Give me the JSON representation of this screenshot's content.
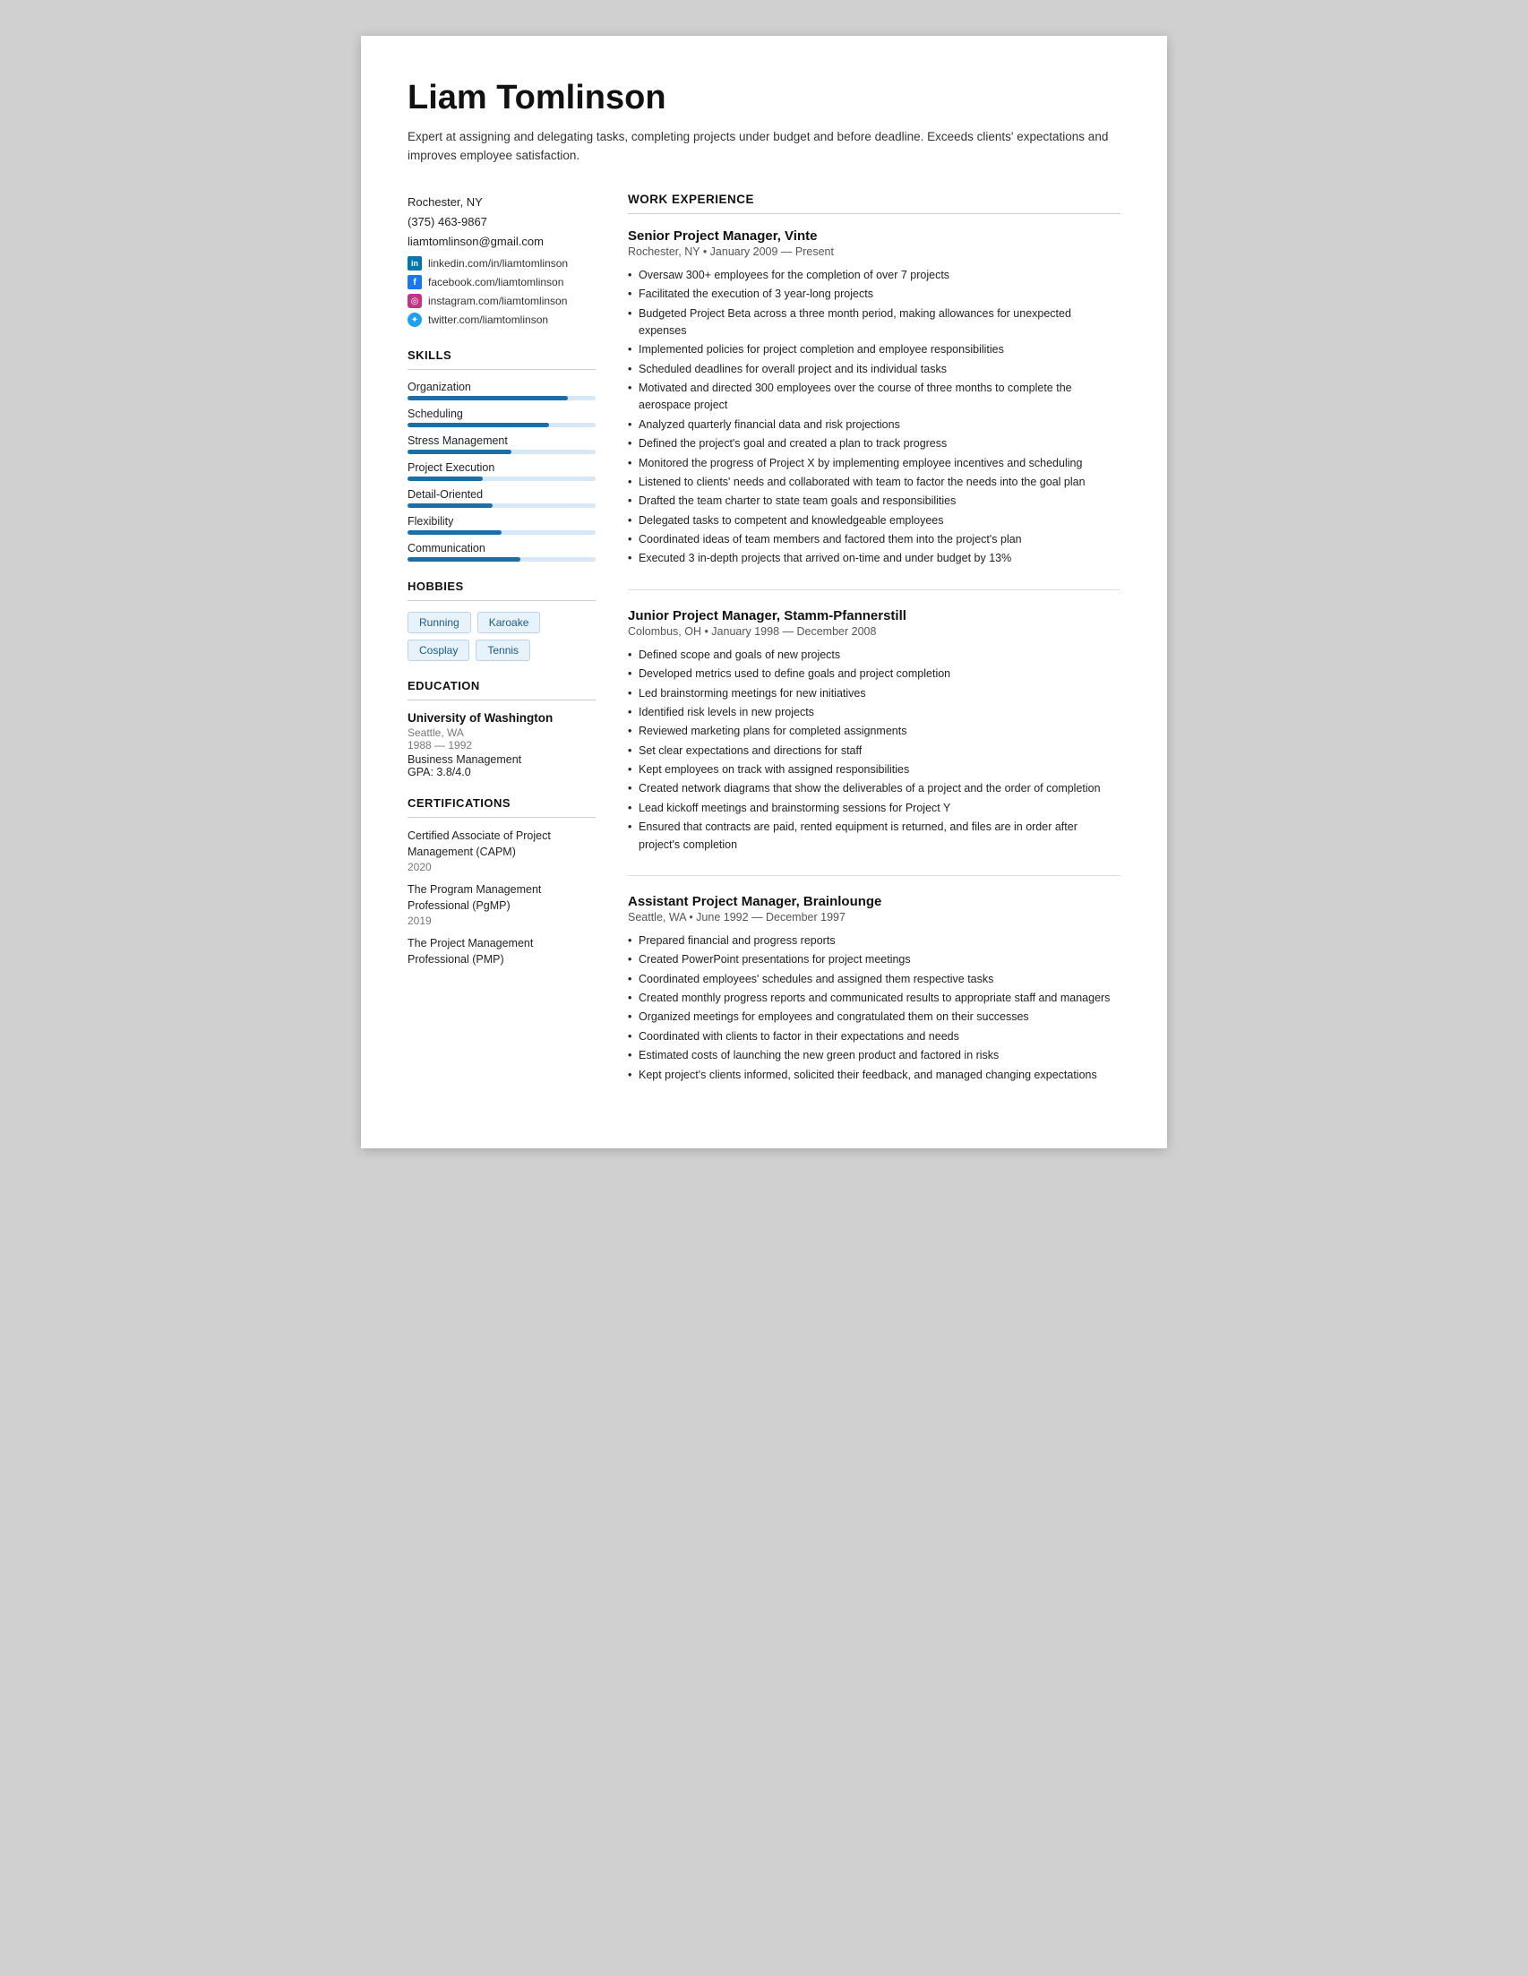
{
  "header": {
    "name": "Liam Tomlinson",
    "summary": "Expert at assigning and delegating tasks, completing projects under budget and before deadline. Exceeds clients' expectations and improves employee satisfaction."
  },
  "contact": {
    "location": "Rochester, NY",
    "phone": "(375) 463-9867",
    "email": "liamtomlinson@gmail.com",
    "socials": [
      {
        "id": "linkedin",
        "icon": "in",
        "label": "linkedin.com/in/liamtomlinson"
      },
      {
        "id": "facebook",
        "icon": "f",
        "label": "facebook.com/liamtomlinson"
      },
      {
        "id": "instagram",
        "icon": "◎",
        "label": "instagram.com/liamtomlinson"
      },
      {
        "id": "twitter",
        "icon": "✦",
        "label": "twitter.com/liamtomlinson"
      }
    ]
  },
  "skills": {
    "section_title": "SKILLS",
    "items": [
      {
        "label": "Organization",
        "pct": 85
      },
      {
        "label": "Scheduling",
        "pct": 75
      },
      {
        "label": "Stress Management",
        "pct": 55
      },
      {
        "label": "Project Execution",
        "pct": 40
      },
      {
        "label": "Detail-Oriented",
        "pct": 45
      },
      {
        "label": "Flexibility",
        "pct": 50
      },
      {
        "label": "Communication",
        "pct": 60
      }
    ]
  },
  "hobbies": {
    "section_title": "HOBBIES",
    "items": [
      "Running",
      "Karoake",
      "Cosplay",
      "Tennis"
    ]
  },
  "education": {
    "section_title": "EDUCATION",
    "entries": [
      {
        "school": "University of Washington",
        "location": "Seattle, WA",
        "years": "1988 — 1992",
        "field": "Business Management",
        "gpa": "GPA: 3.8/4.0"
      }
    ]
  },
  "certifications": {
    "section_title": "CERTIFICATIONS",
    "entries": [
      {
        "name": "Certified Associate of Project Management (CAPM)",
        "year": "2020"
      },
      {
        "name": "The Program Management Professional (PgMP)",
        "year": "2019"
      },
      {
        "name": "The Project Management Professional (PMP)",
        "year": ""
      }
    ]
  },
  "work_experience": {
    "section_title": "WORK EXPERIENCE",
    "jobs": [
      {
        "title": "Senior Project Manager, Vinte",
        "meta": "Rochester, NY • January 2009 — Present",
        "bullets": [
          "Oversaw 300+ employees for the completion of over 7 projects",
          "Facilitated the execution of 3 year-long projects",
          "Budgeted Project Beta across a three month period, making allowances for unexpected expenses",
          "Implemented policies for project completion and employee responsibilities",
          "Scheduled deadlines for overall project and its individual tasks",
          "Motivated and directed 300 employees over the course of three months to complete the aerospace project",
          "Analyzed quarterly financial data and risk projections",
          "Defined the project's goal and created a plan to track progress",
          "Monitored the progress of Project X by implementing employee incentives and scheduling",
          "Listened to clients' needs and collaborated with team to factor the needs into the goal plan",
          "Drafted the team charter to state team goals and responsibilities",
          "Delegated tasks to competent and knowledgeable employees",
          "Coordinated ideas of team members and factored them into the project's plan",
          "Executed 3 in-depth projects that arrived on-time and under budget by 13%"
        ]
      },
      {
        "title": "Junior Project Manager, Stamm-Pfannerstill",
        "meta": "Colombus, OH • January 1998 — December 2008",
        "bullets": [
          "Defined scope and goals of new projects",
          "Developed metrics used to define goals and project completion",
          "Led brainstorming meetings for new initiatives",
          "Identified risk levels in new projects",
          "Reviewed marketing plans for completed assignments",
          "Set clear expectations and directions for staff",
          "Kept employees on track with assigned responsibilities",
          "Created network diagrams that show the deliverables of a project and the order of completion",
          "Lead kickoff meetings and brainstorming sessions for Project Y",
          "Ensured that contracts are paid, rented equipment is returned, and files are in order after project's completion"
        ]
      },
      {
        "title": "Assistant Project Manager, Brainlounge",
        "meta": "Seattle, WA • June 1992 — December 1997",
        "bullets": [
          "Prepared financial and progress reports",
          "Created PowerPoint presentations for project meetings",
          "Coordinated employees' schedules and assigned them respective tasks",
          "Created monthly progress reports and communicated results to appropriate staff and managers",
          "Organized meetings for employees and congratulated them on their successes",
          "Coordinated with clients to factor in their expectations and needs",
          "Estimated costs of launching the new green product and factored in risks",
          "Kept project's clients informed, solicited their feedback, and managed changing expectations"
        ]
      }
    ]
  }
}
